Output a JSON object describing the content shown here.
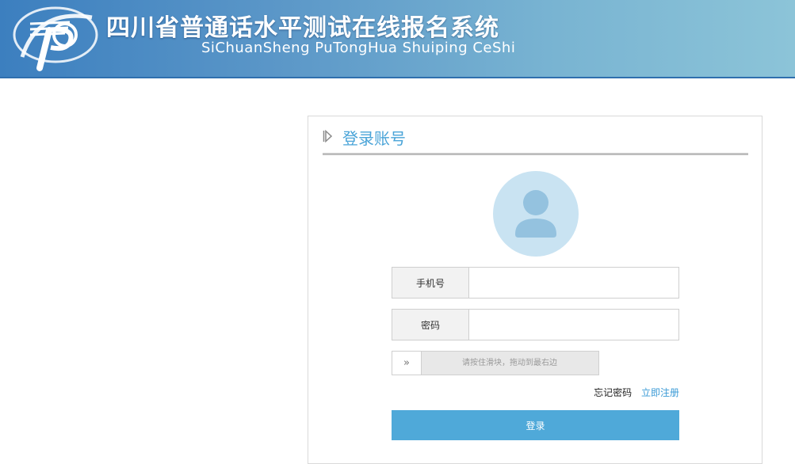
{
  "header": {
    "title": "四川省普通话水平测试在线报名系统",
    "subtitle": "SiChuanSheng PuTongHua Shuiping CeShi"
  },
  "login": {
    "title": "登录账号",
    "phone_label": "手机号",
    "phone_value": "",
    "password_label": "密码",
    "password_value": "",
    "slider_handle": "»",
    "slider_text": "请按住滑块，拖动到最右边",
    "forgot_password": "忘记密码",
    "register": "立即注册",
    "login_button": "登录"
  },
  "colors": {
    "accent": "#4aa4d8",
    "button": "#4fa9d9",
    "header_dark": "#3c7fbf",
    "header_light": "#8cc4d8"
  }
}
